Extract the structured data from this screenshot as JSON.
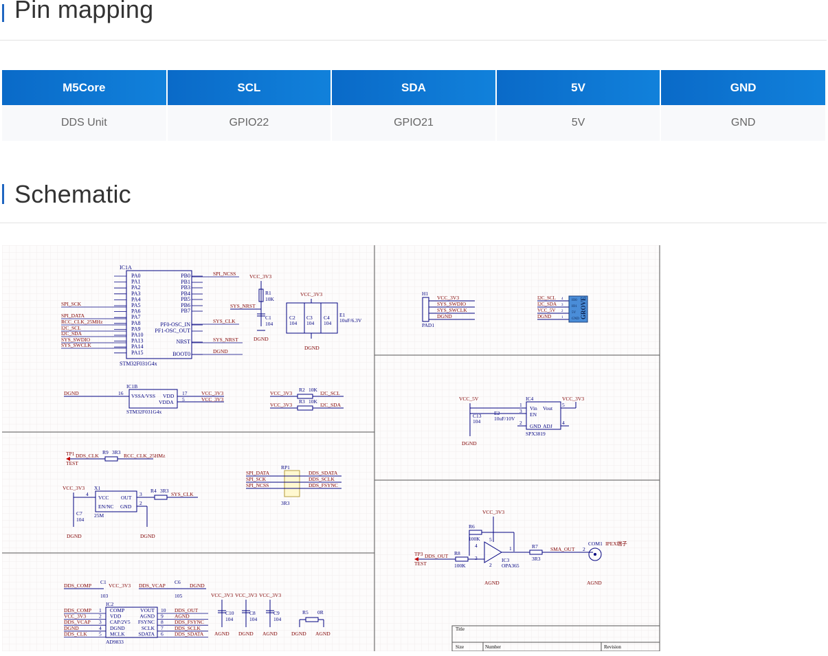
{
  "sections": {
    "pin_mapping": "Pin mapping",
    "schematic": "Schematic"
  },
  "pin_table": {
    "headers": [
      "M5Core",
      "SCL",
      "SDA",
      "5V",
      "GND"
    ],
    "rows": [
      [
        "DDS Unit",
        "GPIO22",
        "GPIO21",
        "5V",
        "GND"
      ]
    ]
  },
  "schematic": {
    "ic1a": {
      "ref": "IC1A",
      "part": "STM32F031G4x",
      "left_pins": [
        "PA0",
        "PA1",
        "PA2",
        "PA3",
        "PA4",
        "PA5",
        "PA6",
        "PA7",
        "PA8",
        "PA9",
        "PA10",
        "PA13",
        "PA14",
        "PA15"
      ],
      "right_pins": [
        "PB0",
        "PB1",
        "PB3",
        "PB4",
        "PB5",
        "PB6",
        "PB7",
        "PF0-OSC_IN",
        "PF1-OSC_OUT",
        "NRST",
        "BOOT0"
      ],
      "left_nets": [
        "SPI_SCK",
        "SPI_DATA",
        "RCC_CLK_25MHz",
        "I2C_SCL",
        "I2C_SDA",
        "SYS_SWDIO",
        "SYS_SWCLK"
      ],
      "right_nets": [
        "SPI_NCSS",
        "SYS_CLK",
        "SYS_NRST",
        "DGND"
      ]
    },
    "rst": {
      "net": "VCC_3V3",
      "r": "R1",
      "rv": "10K",
      "sig": "SYS_NRST",
      "c": "C1",
      "cv": "104",
      "gnd": "DGND"
    },
    "decoupling": {
      "net": "VCC_3V3",
      "caps": [
        "C2",
        "C3",
        "C4",
        "E1"
      ],
      "vals": [
        "104",
        "104",
        "104",
        "10uF/6.3V"
      ],
      "gnd": "DGND"
    },
    "h1": {
      "ref": "H1",
      "pad": "PAD1",
      "nets": [
        "VCC_3V3",
        "SYS_SWDIO",
        "SYS_SWCLK",
        "DGND"
      ]
    },
    "grove": {
      "nets": [
        "I2C_SCL",
        "I2C_SDA",
        "VCC_5V",
        "DGND"
      ],
      "pins": [
        "IO0",
        "IO1",
        "5V",
        "GND"
      ],
      "nums": [
        "4",
        "3",
        "2",
        "1"
      ],
      "label": "GROVE"
    },
    "ic1b": {
      "ref": "IC1B",
      "part": "STM32F031G4x",
      "left": "VSSA/VSS",
      "r1": "VDD",
      "r2": "VDDA",
      "gnd": "DGND",
      "p16": "16",
      "p17": "17",
      "p5": "5",
      "v1": "VCC_3V3",
      "v2": "VCC_3V3"
    },
    "pullups": [
      {
        "net": "VCC_3V3",
        "r": "R2",
        "v": "10K",
        "sig": "I2C_SCL"
      },
      {
        "net": "VCC_3V3",
        "r": "R3",
        "v": "10K",
        "sig": "I2C_SDA"
      }
    ],
    "ldo": {
      "vin": "VCC_5V",
      "ref": "IC4",
      "part": "SPX3819",
      "pins": [
        "Vin",
        "Vout",
        "EN",
        "GND",
        "ADJ"
      ],
      "c": "C13",
      "cv": "104",
      "e": "E2",
      "ev": "10uF/10V",
      "vout": "VCC_3V3",
      "gnd": "DGND",
      "p1": "1",
      "p3": "3",
      "p2": "2",
      "p5": "5",
      "p4": "4"
    },
    "tp1": {
      "ref": "TP1",
      "type": "TEST",
      "net": "DDS_CLK",
      "r": "R9",
      "rv": "3R3",
      "sig": "RCC_CLK_25HMz"
    },
    "rp1": {
      "ref": "RP1",
      "v": "3R3",
      "left": [
        "SPI_DATA",
        "SPI_SCK",
        "SPI_NCSS"
      ],
      "right": [
        "DDS_SDATA",
        "DDS_SCLK",
        "DDS_FSYNC"
      ]
    },
    "x1": {
      "ref": "X1",
      "freq": "25M",
      "net": "VCC_3V3",
      "pins": [
        "VCC",
        "OUT",
        "EN/NC",
        "GND"
      ],
      "r": "R4",
      "rv": "3R3",
      "sig": "SYS_CLK",
      "c": "C7",
      "cv": "104",
      "gnd1": "DGND",
      "gnd2": "DGND",
      "p4": "4",
      "p3": "3",
      "p2": "2"
    },
    "opamp": {
      "net": "VCC_3V3",
      "r6": "R6",
      "r6v": "100K",
      "r8": "R8",
      "r8v": "100K",
      "tp": "TP3",
      "tptype": "TEST",
      "in": "DDS_OUT",
      "ic": "IC3",
      "part": "OPA365",
      "r7": "R7",
      "r7v": "3R3",
      "out": "SMA_OUT",
      "com": "COM1",
      "conn": "IPEX端子",
      "gnd1": "AGND",
      "gnd2": "AGND",
      "p4": "4",
      "p3": "3",
      "p1": "1",
      "p5": "5",
      "p2": "2",
      "cp2": "2"
    },
    "caps": {
      "c1": "C1",
      "c1v": "103",
      "c1n": "VCC_3V3",
      "c6": "C6",
      "c6v": "105",
      "n1": "DDS_COMP",
      "n2": "DDS_VCAP",
      "g": "DGND"
    },
    "ic2": {
      "ref": "IC2",
      "part": "AD9833",
      "left": [
        "COMP",
        "VDD",
        "CAP/2V5",
        "DGND",
        "MCLK"
      ],
      "right": [
        "VOUT",
        "AGND",
        "FSYNC",
        "SCLK",
        "SDATA"
      ],
      "lnum": [
        "1",
        "2",
        "3",
        "4",
        "5"
      ],
      "rnum": [
        "10",
        "9",
        "8",
        "7",
        "6"
      ],
      "lnets": [
        "DDS_COMP",
        "VCC_3V3",
        "DDS_VCAP",
        "DGND",
        "DDS_CLK"
      ],
      "rnets": [
        "DDS_OUT",
        "AGND",
        "DDS_FSYNC",
        "DDS_SCLK",
        "DDS_SDATA"
      ]
    },
    "bottom_caps": {
      "refs": [
        "C10",
        "C8",
        "C9"
      ],
      "vals": [
        "104",
        "104",
        "104"
      ],
      "nets": [
        "VCC_3V3",
        "VCC_3V3",
        "VCC_3V3"
      ],
      "gnds": [
        "AGND",
        "DGND",
        "AGND"
      ]
    },
    "r5": {
      "ref": "R5",
      "v": "0R",
      "g1": "DGND",
      "g2": "AGND"
    },
    "title_block": {
      "title": "Title",
      "size": "Size",
      "number": "Number",
      "revision": "Revision"
    }
  },
  "colors": {
    "accent": "#1f66c1",
    "header_bg": "#0f79d6",
    "wire": "#000080",
    "net": "#800000",
    "grid": "#f2eeee",
    "grove": "#4a8dd8"
  }
}
